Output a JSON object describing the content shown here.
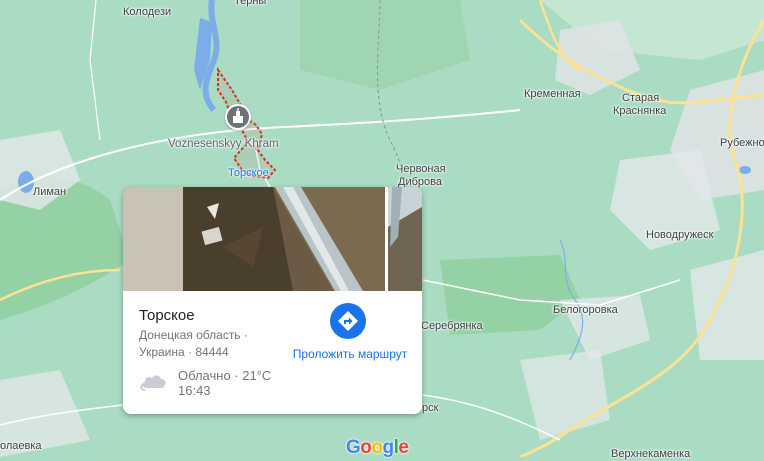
{
  "map": {
    "towns": {
      "kolodezi": "Колодези",
      "terny": "Терны",
      "liman": "Лиман",
      "kremennaya": "Кременная",
      "staraya_krasnyanka_1": "Старая",
      "staraya_krasnyanka_2": "Краснянка",
      "rubezhnoe": "Рубежно",
      "chervonaya_1": "Червоная",
      "chervonaya_2": "Диброва",
      "novodruzheck": "Новодружеск",
      "belogorovka": "Белогоровка",
      "serebryanka": "Серебрянка",
      "torsk": "рск",
      "nikolaevka": "олаевка",
      "verkhnekamenka": "Верхнекаменка"
    },
    "poi_name": "Voznesenskyy Khram",
    "selected_place_label": "Торское",
    "colors": {
      "land": "#aadcc3",
      "forest": "#94d2a5",
      "urban": "#e8eaed",
      "road_major": "#fde293",
      "water": "#7baee8",
      "boundary_highlight": "#d93025"
    },
    "icons": {
      "poi": "church-icon",
      "directions": "directions-arrow-icon",
      "weather": "cloud-icon"
    }
  },
  "place_card": {
    "title": "Торское",
    "address_line1": "Донецкая область ·",
    "address_line2": "Украина · 84444",
    "directions_label": "Проложить маршрут",
    "weather": {
      "condition": "Облачно · 21°C",
      "time": "16:43"
    }
  },
  "brand": {
    "logo": "Google"
  }
}
